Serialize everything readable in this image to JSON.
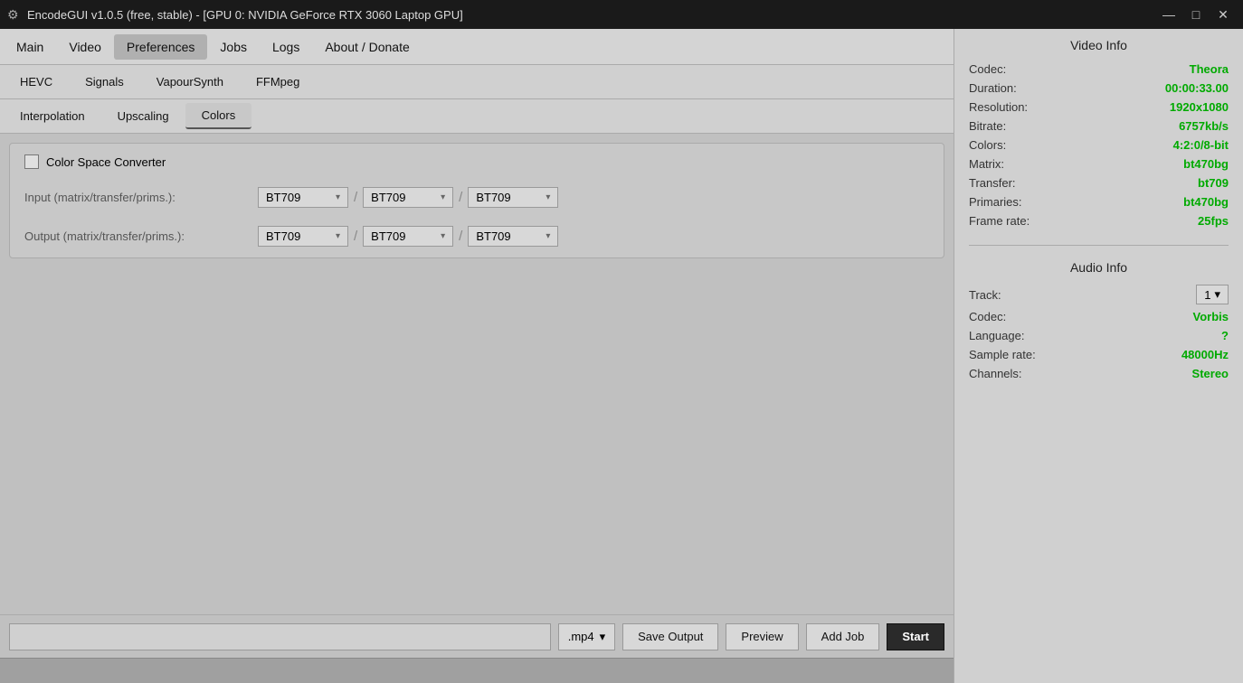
{
  "window": {
    "title": "EncodeGUI v1.0.5 (free, stable) - [GPU 0: NVIDIA GeForce RTX 3060 Laptop GPU]"
  },
  "titlebar": {
    "icon": "⚙",
    "minimize": "—",
    "maximize": "□",
    "close": "✕"
  },
  "menu": {
    "items": [
      {
        "id": "main",
        "label": "Main"
      },
      {
        "id": "video",
        "label": "Video"
      },
      {
        "id": "preferences",
        "label": "Preferences"
      },
      {
        "id": "jobs",
        "label": "Jobs"
      },
      {
        "id": "logs",
        "label": "Logs"
      },
      {
        "id": "about",
        "label": "About / Donate"
      }
    ]
  },
  "subtabs1": {
    "items": [
      {
        "id": "hevc",
        "label": "HEVC"
      },
      {
        "id": "signals",
        "label": "Signals"
      },
      {
        "id": "vapoursynth",
        "label": "VapourSynth"
      },
      {
        "id": "ffmpeg",
        "label": "FFMpeg"
      }
    ]
  },
  "subtabs2": {
    "items": [
      {
        "id": "interpolation",
        "label": "Interpolation"
      },
      {
        "id": "upscaling",
        "label": "Upscaling"
      },
      {
        "id": "colors",
        "label": "Colors"
      }
    ]
  },
  "colors_panel": {
    "checkbox_label": "Color Space Converter",
    "checkbox_checked": false,
    "input_label": "Input (matrix/transfer/prims.):",
    "output_label": "Output (matrix/transfer/prims.):",
    "input_values": [
      "BT709",
      "BT709",
      "BT709"
    ],
    "output_values": [
      "BT709",
      "BT709",
      "BT709"
    ],
    "slash": "/"
  },
  "bottom_bar": {
    "output_path": "",
    "output_path_placeholder": "",
    "format_label": ".mp4",
    "save_output": "Save Output",
    "preview": "Preview",
    "add_job": "Add Job",
    "start": "Start"
  },
  "video_info": {
    "title": "Video Info",
    "rows": [
      {
        "label": "Codec:",
        "value": "Theora"
      },
      {
        "label": "Duration:",
        "value": "00:00:33.00"
      },
      {
        "label": "Resolution:",
        "value": "1920x1080"
      },
      {
        "label": "Bitrate:",
        "value": "6757kb/s"
      },
      {
        "label": "Colors:",
        "value": "4:2:0/8-bit"
      },
      {
        "label": "Matrix:",
        "value": "bt470bg"
      },
      {
        "label": "Transfer:",
        "value": "bt709"
      },
      {
        "label": "Primaries:",
        "value": "bt470bg"
      },
      {
        "label": "Frame rate:",
        "value": "25fps"
      }
    ]
  },
  "audio_info": {
    "title": "Audio Info",
    "track_label": "Track:",
    "track_value": "1",
    "rows": [
      {
        "label": "Codec:",
        "value": "Vorbis"
      },
      {
        "label": "Language:",
        "value": "?"
      },
      {
        "label": "Sample rate:",
        "value": "48000Hz"
      },
      {
        "label": "Channels:",
        "value": "Stereo"
      }
    ]
  }
}
